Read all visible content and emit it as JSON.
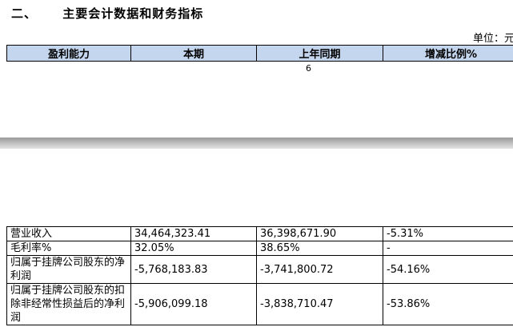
{
  "section": {
    "number": "二、",
    "title": "主要会计数据和财务指标"
  },
  "unit_label": "单位：元",
  "header": [
    "盈利能力",
    "本期",
    "上年同期",
    "增减比例%"
  ],
  "page_number": "6",
  "rows": [
    {
      "label": "营业收入",
      "current": "34,464,323.41",
      "prior": "36,398,671.90",
      "change": "-5.31%"
    },
    {
      "label": "毛利率%",
      "current": "32.05%",
      "prior": "38.65%",
      "change": "-"
    },
    {
      "label": "归属于挂牌公司股东的净利润",
      "current": "-5,768,183.83",
      "prior": "-3,741,800.72",
      "change": "-54.16%"
    },
    {
      "label": "归属于挂牌公司股东的扣除非经常性损益后的净利润",
      "current": "-5,906,099.18",
      "prior": "-3,838,710.47",
      "change": "-53.86%"
    }
  ]
}
